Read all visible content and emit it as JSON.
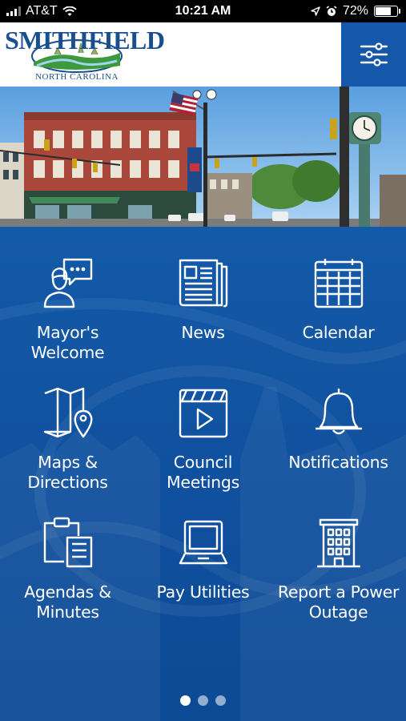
{
  "status_bar": {
    "carrier": "AT&T",
    "time": "10:21 AM",
    "battery": "72%",
    "battery_level": 0.72,
    "icons": [
      "signal-icon",
      "wifi-icon",
      "location-icon",
      "alarm-icon",
      "battery-icon"
    ]
  },
  "header": {
    "logo_title": "SMITHFIELD",
    "logo_subtitle": "NORTH CAROLINA",
    "menu_icon": "sliders-icon"
  },
  "colors": {
    "brand_blue": "#135aa8",
    "menu_blue": "#1557a8",
    "text_white": "#ffffff"
  },
  "tiles": [
    {
      "label_line1": "Mayor's",
      "label_line2": "Welcome",
      "icon": "speech-person-icon"
    },
    {
      "label_line1": "News",
      "label_line2": "",
      "icon": "newspaper-icon"
    },
    {
      "label_line1": "Calendar",
      "label_line2": "",
      "icon": "calendar-icon"
    },
    {
      "label_line1": "Maps &",
      "label_line2": "Directions",
      "icon": "map-pin-icon"
    },
    {
      "label_line1": "Council",
      "label_line2": "Meetings",
      "icon": "video-clapper-icon"
    },
    {
      "label_line1": "Notifications",
      "label_line2": "",
      "icon": "bell-icon"
    },
    {
      "label_line1": "Agendas &",
      "label_line2": "Minutes",
      "icon": "clipboard-docs-icon"
    },
    {
      "label_line1": "Pay Utilities",
      "label_line2": "",
      "icon": "laptop-icon"
    },
    {
      "label_line1": "Report a Power",
      "label_line2": "Outage",
      "icon": "building-icon"
    }
  ],
  "pagination": {
    "total_pages": 3,
    "current_page": 1
  }
}
